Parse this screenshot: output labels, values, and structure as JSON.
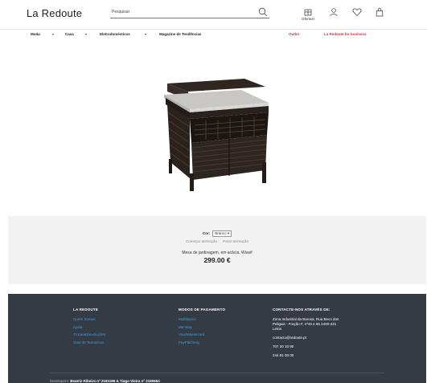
{
  "header": {
    "logo": "La Redoute",
    "search": {
      "placeholder": "Pesquisar",
      "value": ""
    },
    "ofertas_label": "Ofertas!",
    "icons": [
      "search-icon",
      "gift-icon",
      "user-icon",
      "heart-icon",
      "bag-icon"
    ]
  },
  "nav": {
    "items": [
      {
        "label": "Moda",
        "has_dropdown": true
      },
      {
        "label": "Casa",
        "has_dropdown": true
      },
      {
        "label": "Eletrodomésticos",
        "has_dropdown": true
      },
      {
        "label": "Magazine de Tendências",
        "has_dropdown": false
      },
      {
        "label": "Outlet",
        "accent": true
      },
      {
        "label": "La Redoute for business",
        "accent": true
      }
    ]
  },
  "product": {
    "color_label": "Cor:",
    "color_value": "Branco",
    "start_animation": "Começar animação",
    "stop_animation": "Parar animação",
    "name": "Mesa de jardinagem, em acácia, Wiasif",
    "price": "299.00 €"
  },
  "footer": {
    "col1": {
      "heading": "LA REDOUTE",
      "links": [
        "Quem Somos",
        "Ajuda",
        "Trocas&Devoluções",
        "Guia de Tamanhos"
      ]
    },
    "col2": {
      "heading": "MODOS DE PAGAMENTO",
      "links": [
        "Multibanco",
        "MB Way",
        "Visa/Mastercard",
        "PayPal/Oney"
      ]
    },
    "col3": {
      "heading": "CONTACTE-NOS ATRAVÉS DE:",
      "address": [
        "Zona Industrial da Barosa, Rua Beco dos",
        "Peligais - Fração F, nº45 e 65 2400-431",
        "Leiria"
      ],
      "email": "contacto@redoute.pt",
      "phones": [
        "707 20 10 90",
        "244 81 00 00"
      ]
    },
    "credits_prefix": "Developers:",
    "credits_names": "Beatriz Ribeiro nº 2191196 & Tiago Vieira nº 2190654"
  },
  "colors": {
    "accent_red": "#e8283a",
    "footer_bg": "#353b45",
    "footer_link": "#3b9ce0",
    "info_band_bg": "#f2f2f2"
  }
}
